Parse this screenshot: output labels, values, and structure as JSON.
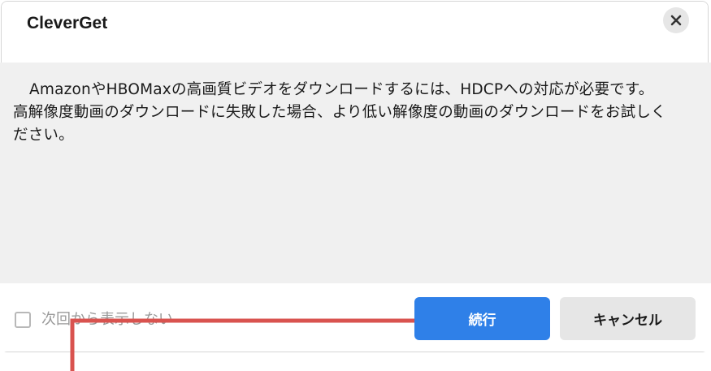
{
  "dialog": {
    "title": "CleverGet",
    "close_icon": "close-icon",
    "message_line1": "AmazonやHBOMaxの高画質ビデオをダウンロードするには、HDCPへの対応が必要です。",
    "message_line2": "高解像度動画のダウンロードに失敗した場合、より低い解像度の動画のダウンロードをお試しく",
    "message_line3": "ださい。",
    "checkbox_label": "次回から表示しない",
    "checkbox_checked": false,
    "continue_label": "続行",
    "cancel_label": "キャンセル"
  },
  "colors": {
    "primary": "#2f80e8",
    "content_bg": "#f0f0f0",
    "annotation_line": "#d9534f"
  }
}
